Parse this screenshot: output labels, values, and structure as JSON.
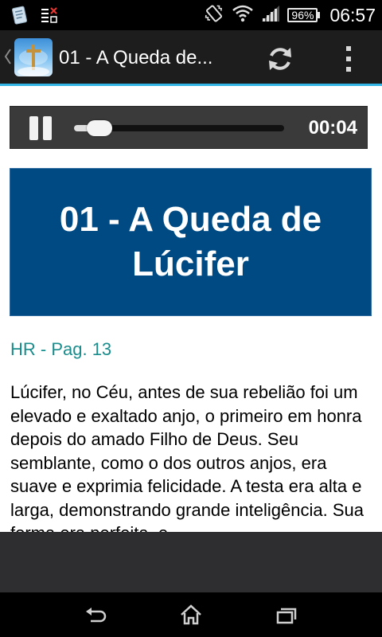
{
  "status_bar": {
    "battery": "96%",
    "time": "06:57",
    "icons": [
      "diary-app-icon",
      "sim-status-icon",
      "vibrate-icon",
      "wifi-icon",
      "signal-icon",
      "battery-icon"
    ]
  },
  "action_bar": {
    "title": "01 - A Queda de...",
    "icons": [
      "up-caret-icon",
      "app-icon",
      "refresh-icon",
      "overflow-menu-icon"
    ]
  },
  "player": {
    "time": "00:04",
    "progress_fraction": 0.06,
    "icons": [
      "pause-icon"
    ]
  },
  "content": {
    "heading": "01 - A Queda de Lúcifer",
    "reference": "HR - Pag. 13",
    "body": "Lúcifer, no Céu, antes de sua rebelião foi um elevado e exaltado anjo, o primeiro em honra depois do amado Filho de Deus. Seu semblante, como o dos outros anjos, era suave e exprimia felicidade. A testa era alta e larga, demonstrando grande inteligência. Sua forma era perfeita, e"
  },
  "nav_bar": {
    "icons": [
      "back-icon",
      "home-icon",
      "recent-apps-icon"
    ]
  },
  "colors": {
    "accent": "#33b5e5",
    "heading_bg": "#004a84",
    "reference_text": "#1a8c8c"
  }
}
